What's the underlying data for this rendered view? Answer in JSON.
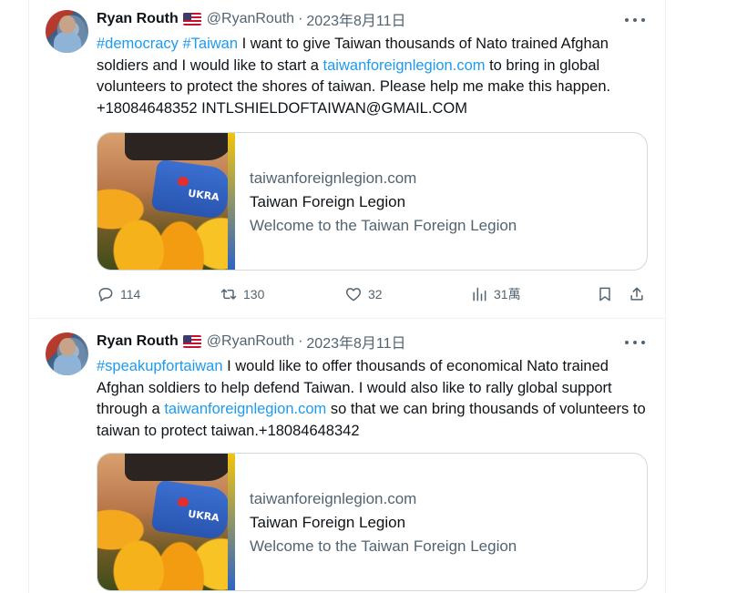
{
  "tweets": [
    {
      "author": {
        "name": "Ryan Routh",
        "handle": "@RyanRouth",
        "date": "2023年8月11日"
      },
      "text_segments": [
        {
          "text": "#democracy",
          "link": true
        },
        {
          "text": " ",
          "link": false
        },
        {
          "text": "#Taiwan",
          "link": true
        },
        {
          "text": " I want to give Taiwan thousands of Nato trained Afghan soldiers and I would like to start a ",
          "link": false
        },
        {
          "text": "taiwanforeignlegion.com",
          "link": true
        },
        {
          "text": " to bring in global volunteers to protect the shores of taiwan.    Please help me make this happen. +18084648352 INTLSHIELDOFTAIWAN@GMAIL.COM",
          "link": false
        }
      ],
      "card": {
        "domain": "taiwanforeignlegion.com",
        "title": "Taiwan Foreign Legion",
        "description": "Welcome to the Taiwan Foreign Legion"
      },
      "actions": {
        "replies": "114",
        "retweets": "130",
        "likes": "32",
        "views": "31萬"
      }
    },
    {
      "author": {
        "name": "Ryan Routh",
        "handle": "@RyanRouth",
        "date": "2023年8月11日"
      },
      "text_segments": [
        {
          "text": "#speakupfortaiwan",
          "link": true
        },
        {
          "text": " I would like to offer thousands of economical Nato trained Afghan soldiers to help defend Taiwan. I would also like to rally global support through a ",
          "link": false
        },
        {
          "text": "taiwanforeignlegion.com",
          "link": true
        },
        {
          "text": " so that we can bring thousands of volunteers to taiwan to protect taiwan.+18084648342",
          "link": false
        }
      ],
      "card": {
        "domain": "taiwanforeignlegion.com",
        "title": "Taiwan Foreign Legion",
        "description": "Welcome to the Taiwan Foreign Legion"
      }
    }
  ],
  "ui": {
    "separator": "·"
  },
  "colors": {
    "link": "#1d9bf0",
    "secondary_text": "#536471",
    "primary_text": "#0f1419",
    "border": "#cfd9de"
  },
  "icons": [
    "user-avatar",
    "us-flag-icon",
    "more-options-icon",
    "reply-icon",
    "retweet-icon",
    "like-icon",
    "views-icon",
    "bookmark-icon",
    "share-icon"
  ]
}
